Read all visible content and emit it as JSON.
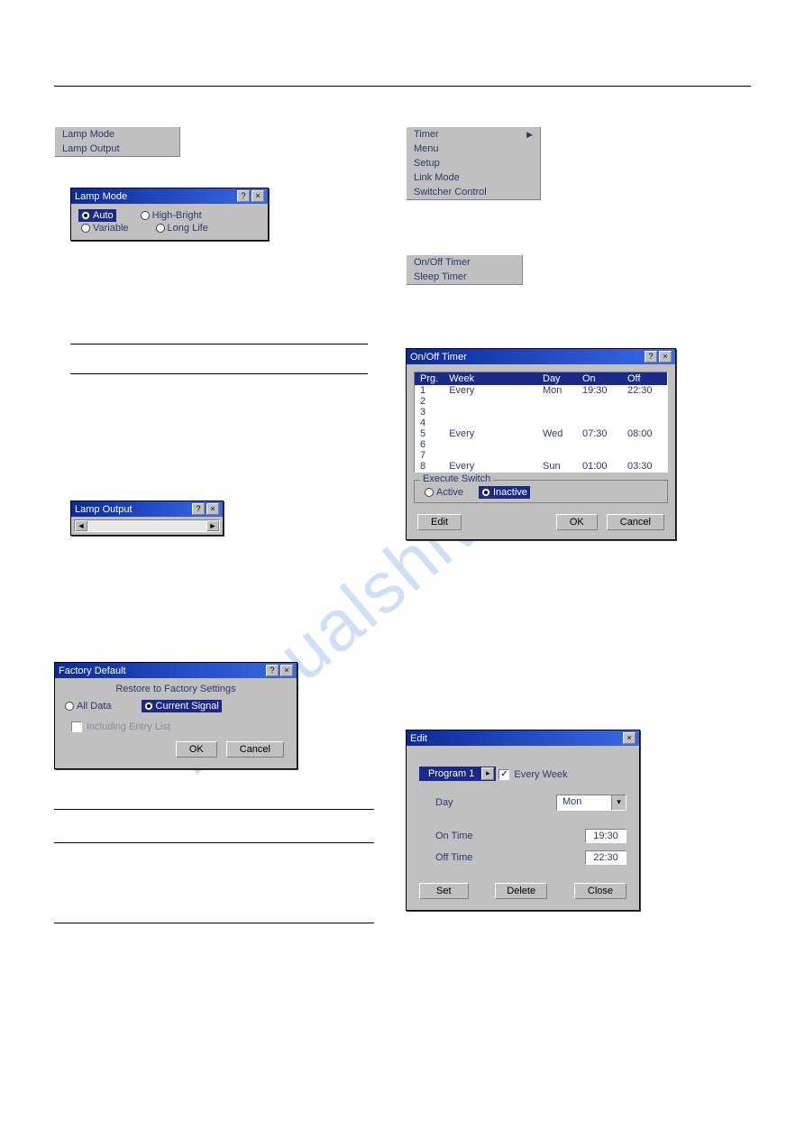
{
  "watermark": "manualshive.com",
  "page_number": "",
  "left": {
    "lamp_menu": {
      "item1": "Lamp Mode",
      "item2": "Lamp Output"
    },
    "lamp_mode_dlg": {
      "title": "Lamp Mode",
      "opt_auto": "Auto",
      "opt_high": "High-Bright",
      "opt_var": "Variable",
      "opt_long": "Long Life"
    },
    "lamp_output_dlg": {
      "title": "Lamp Output"
    },
    "factory_default_dlg": {
      "title": "Factory Default",
      "subtitle": "Restore to Factory Settings",
      "opt_all": "All Data",
      "opt_current": "Current Signal",
      "check_label": "Including Entry List",
      "ok": "OK",
      "cancel": "Cancel"
    }
  },
  "right": {
    "proj_menu": {
      "item1": "Timer",
      "item2": "Menu",
      "item3": "Setup",
      "item4": "Link Mode",
      "item5": "Switcher Control"
    },
    "timer_menu": {
      "item1": "On/Off Timer",
      "item2": "Sleep Timer"
    },
    "onoff_dlg": {
      "title": "On/Off Timer",
      "col_prg": "Prg.",
      "col_week": "Week",
      "col_day": "Day",
      "col_on": "On",
      "col_off": "Off",
      "rows": [
        {
          "n": "1",
          "week": "Every",
          "day": "Mon",
          "on": "19:30",
          "off": "22:30"
        },
        {
          "n": "2",
          "week": "",
          "day": "",
          "on": "",
          "off": ""
        },
        {
          "n": "3",
          "week": "",
          "day": "",
          "on": "",
          "off": ""
        },
        {
          "n": "4",
          "week": "",
          "day": "",
          "on": "",
          "off": ""
        },
        {
          "n": "5",
          "week": "Every",
          "day": "Wed",
          "on": "07:30",
          "off": "08:00"
        },
        {
          "n": "6",
          "week": "",
          "day": "",
          "on": "",
          "off": ""
        },
        {
          "n": "7",
          "week": "",
          "day": "",
          "on": "",
          "off": ""
        },
        {
          "n": "8",
          "week": "Every",
          "day": "Sun",
          "on": "01:00",
          "off": "03:30"
        }
      ],
      "group": "Execute Switch",
      "opt_active": "Active",
      "opt_inactive": "Inactive",
      "edit": "Edit",
      "ok": "OK",
      "cancel": "Cancel"
    },
    "edit_dlg": {
      "title": "Edit",
      "program": "Program 1",
      "every_week": "Every Week",
      "day_label": "Day",
      "day_value": "Mon",
      "on_label": "On  Time",
      "on_value": "19:30",
      "off_label": "Off Time",
      "off_value": "22:30",
      "set": "Set",
      "delete": "Delete",
      "close": "Close"
    }
  }
}
